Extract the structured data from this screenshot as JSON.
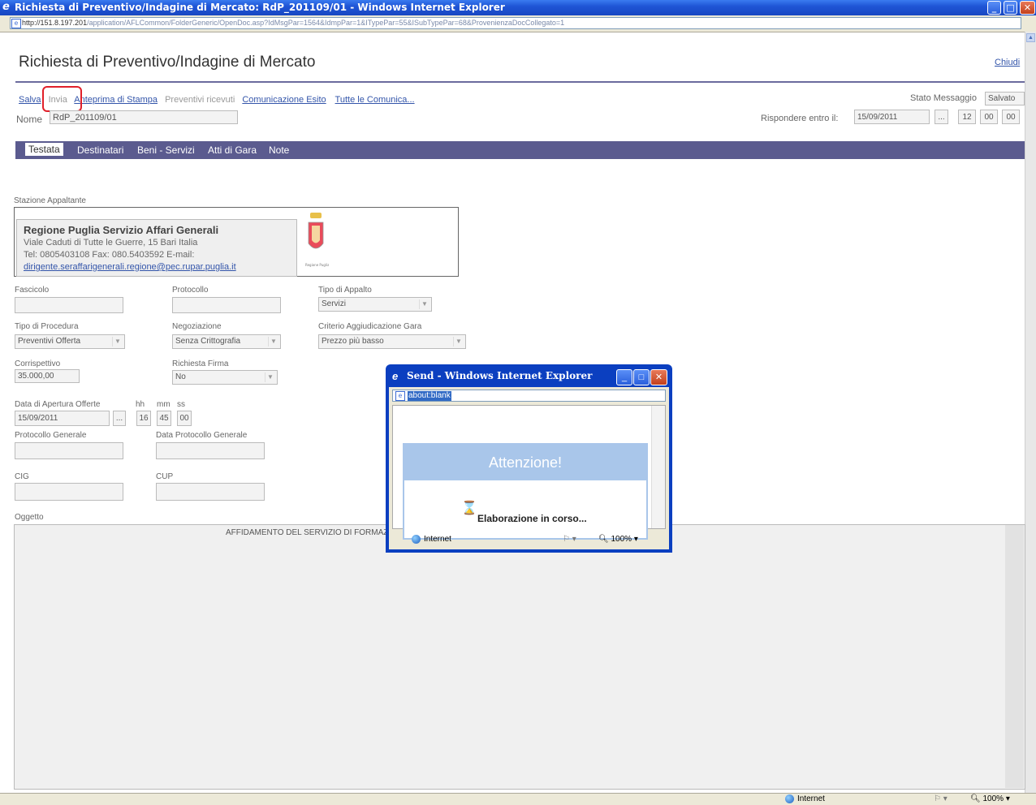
{
  "window": {
    "title": "Richiesta di Preventivo/Indagine di Mercato: RdP_201109/01 - Windows Internet Explorer",
    "address_host": "http://151.8.197.201",
    "address_path": "/application/AFLCommon/FolderGeneric/OpenDoc.asp?IdMsgPar=1564&IdmpPar=1&ITypePar=55&ISubTypePar=68&ProvenienzaDocCollegato=1"
  },
  "page": {
    "title": "Richiesta di Preventivo/Indagine di Mercato",
    "close_label": "Chiudi",
    "toolbar": {
      "salva": "Salva",
      "invia": "Invia",
      "anteprima": "Anteprima di Stampa",
      "preventivi": "Preventivi ricevuti",
      "comunicazione": "Comunicazione Esito",
      "tutte": "Tutte le Comunica..."
    },
    "stato_label": "Stato Messaggio",
    "stato_value": "Salvato",
    "nome_label": "Nome",
    "nome_value": "RdP_201109/01",
    "rispondere_label": "Rispondere entro il:",
    "rispondere_date": "15/09/2011",
    "rispondere_btn": "...",
    "rispondere_hh": "12",
    "rispondere_mm": "00",
    "rispondere_ss": "00"
  },
  "tabs": [
    "Testata",
    "Destinatari",
    "Beni - Servizi",
    "Atti di Gara",
    "Note"
  ],
  "stazione": {
    "label": "Stazione Appaltante",
    "name": "Regione Puglia Servizio Affari Generali",
    "address": "Viale Caduti di Tutte le Guerre, 15 Bari Italia",
    "contacts": "Tel: 0805403108 Fax: 080.5403592 E-mail:",
    "email": "dirigente.seraffarigenerali.regione@pec.rupar.puglia.it"
  },
  "form": {
    "fascicolo_label": "Fascicolo",
    "protocollo_label": "Protocollo",
    "tipo_appalto_label": "Tipo di Appalto",
    "tipo_appalto_value": "Servizi",
    "tipo_procedura_label": "Tipo di Procedura",
    "tipo_procedura_value": "Preventivi Offerta",
    "negoziazione_label": "Negoziazione",
    "negoziazione_value": "Senza Crittografia",
    "criterio_label": "Criterio Aggiudicazione Gara",
    "criterio_value": "Prezzo più basso",
    "corrispettivo_label": "Corrispettivo",
    "corrispettivo_value": "35.000,00",
    "richiesta_firma_label": "Richiesta Firma",
    "richiesta_firma_value": "No",
    "apertura_label": "Data di Apertura Offerte",
    "apertura_date": "15/09/2011",
    "apertura_btn": "...",
    "hh_label": "hh",
    "mm_label": "mm",
    "ss_label": "ss",
    "hh": "16",
    "mm": "45",
    "ss": "00",
    "protocollo_generale_label": "Protocollo Generale",
    "data_protocollo_label": "Data Protocollo Generale",
    "cig_label": "CIG",
    "cup_label": "CUP",
    "oggetto_label": "Oggetto",
    "oggetto_value": "AFFIDAMENTO DEL SERVIZIO DI FORMAZ"
  },
  "popup": {
    "title": "Send - Windows Internet Explorer",
    "address": "about:blank",
    "heading": "Attenzione!",
    "message": "Elaborazione in corso...",
    "status_zone": "Internet",
    "zoom": "100%"
  },
  "statusbar": {
    "zone": "Internet",
    "zoom": "100%"
  }
}
